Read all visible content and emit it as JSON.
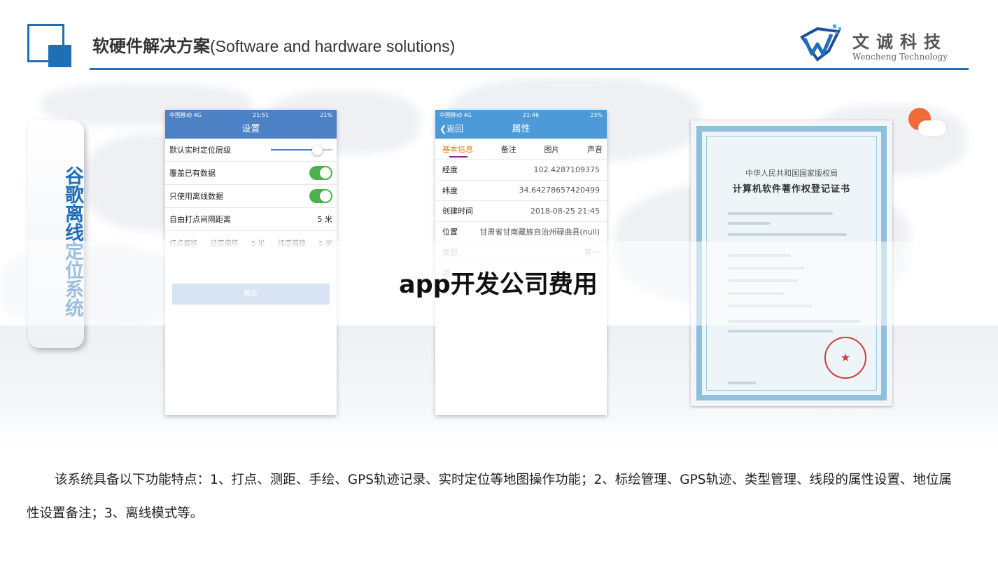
{
  "header": {
    "title_cn": "软硬件解决方案",
    "title_en": "(Software and hardware solutions)",
    "brand_cn": "文诚科技",
    "brand_en": "Wencheng Technology",
    "accent_color": "#1f6fb6"
  },
  "side_label": "谷歌离线定位系统",
  "phone_settings": {
    "status": {
      "carrier": "中国移动 4G",
      "time": "21:51",
      "battery": "21%"
    },
    "nav_title": "设置",
    "rows": [
      {
        "label": "默认实时定位层级",
        "control": "slider",
        "level": 0.75
      },
      {
        "label": "覆盖已有数据",
        "control": "toggle",
        "on": true
      },
      {
        "label": "只使用离线数据",
        "control": "toggle",
        "on": true
      },
      {
        "label": "自由打点间隔距离",
        "value": "5 米"
      }
    ],
    "offset_row": {
      "label": "打点偏移",
      "lon_label": "经度偏移",
      "lon_value": "5 米",
      "lat_label": "纬度偏移",
      "lat_value": "5 米"
    },
    "confirm_label": "确定",
    "header_color": "#4c82c5"
  },
  "phone_attributes": {
    "status": {
      "carrier": "中国移动 4G",
      "time": "21:46",
      "battery": "23%"
    },
    "back_label": "返回",
    "nav_title": "属性",
    "tabs": [
      "基本信息",
      "备注",
      "图片",
      "声音"
    ],
    "rows": [
      {
        "label": "经度",
        "value": "102.4287109375"
      },
      {
        "label": "纬度",
        "value": "34.64278657420499"
      },
      {
        "label": "创建时间",
        "value": "2018-08-25 21:45"
      },
      {
        "label": "位置",
        "value": "甘肃省甘南藏族自治州碌曲县(null)"
      },
      {
        "label": "类型",
        "value": "第一"
      }
    ],
    "partial_label": "用",
    "header_color": "#4c9ad7"
  },
  "certificate": {
    "authority": "中华人民共和国国家版权局",
    "title": "计算机软件著作权登记证书",
    "seal_glyph": "★"
  },
  "overlay_caption": "app开发公司费用",
  "description": "该系统具备以下功能特点：1、打点、测距、手绘、GPS轨迹记录、实时定位等地图操作功能；2、标绘管理、GPS轨迹、类型管理、线段的属性设置、地位属性设置备注；3、离线模式等。"
}
